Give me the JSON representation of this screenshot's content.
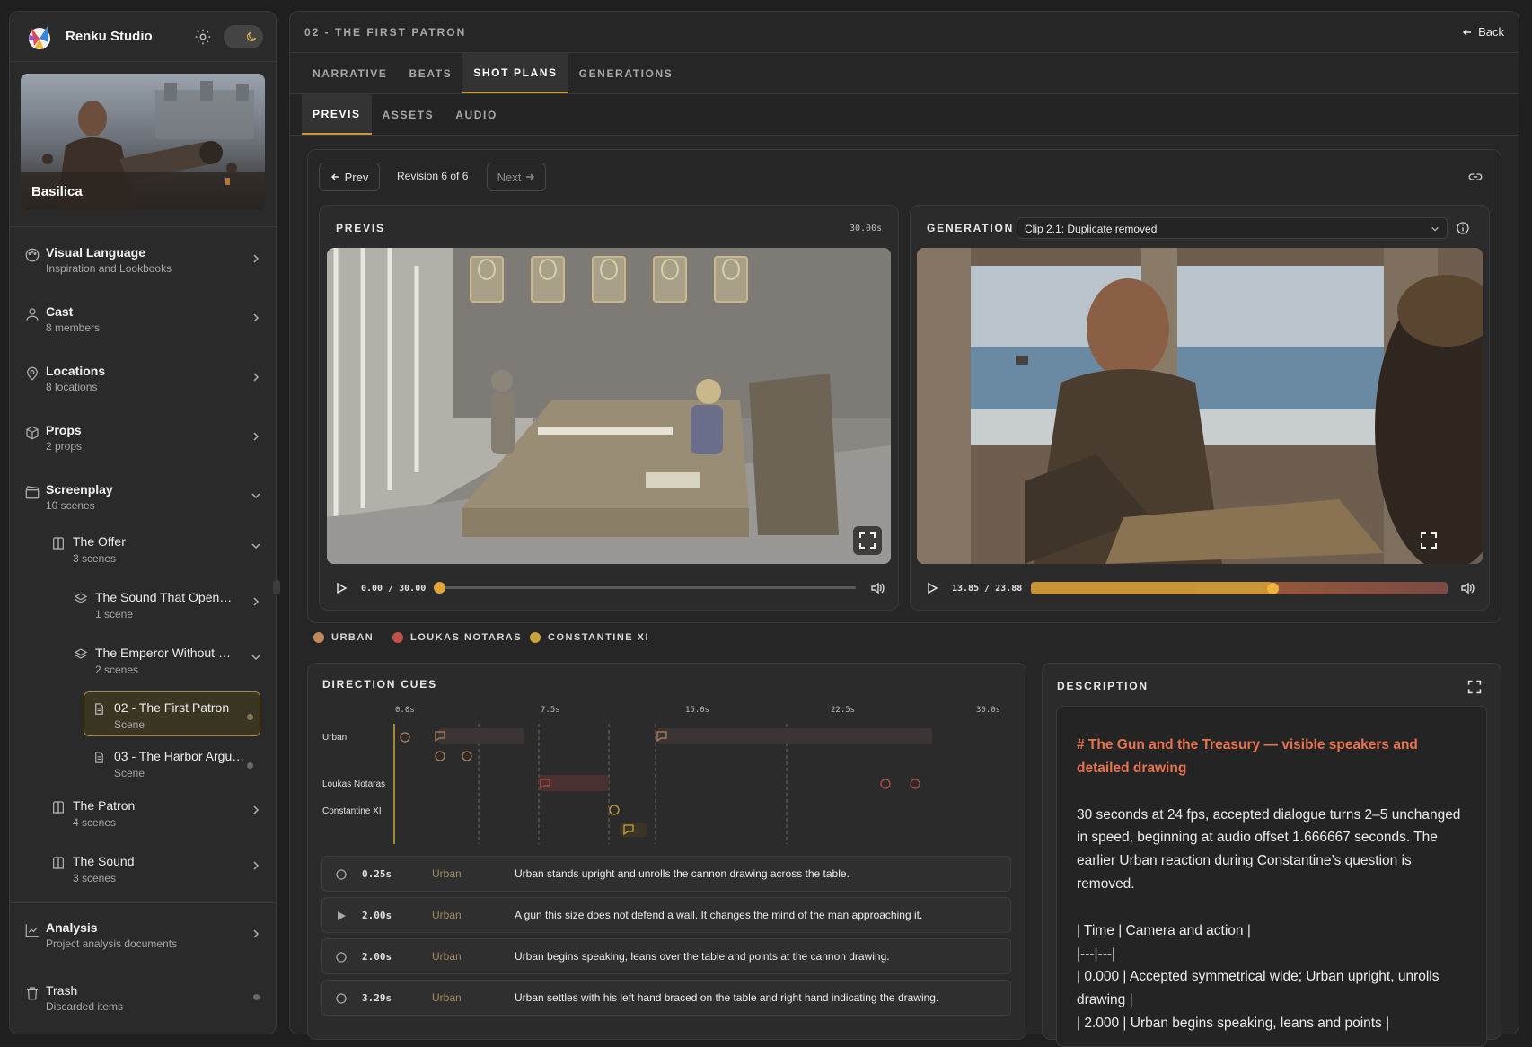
{
  "app": {
    "title": "Renku Studio"
  },
  "project": {
    "name": "Basilica"
  },
  "sidebar": {
    "items": [
      {
        "label": "Visual Language",
        "sub": "Inspiration and Lookbooks",
        "icon": "palette-icon"
      },
      {
        "label": "Cast",
        "sub": "8 members",
        "icon": "user-icon"
      },
      {
        "label": "Locations",
        "sub": "8 locations",
        "icon": "map-pin-icon"
      },
      {
        "label": "Props",
        "sub": "2 props",
        "icon": "box-icon"
      },
      {
        "label": "Screenplay",
        "sub": "10 scenes",
        "icon": "clapperboard-icon"
      },
      {
        "label": "Analysis",
        "sub": "Project analysis documents",
        "icon": "chart-icon"
      },
      {
        "label": "Trash",
        "sub": "Discarded items",
        "icon": "trash-icon"
      }
    ],
    "acts": [
      {
        "label": "The Offer",
        "sub": "3 scenes"
      },
      {
        "label": "The Patron",
        "sub": "4 scenes"
      },
      {
        "label": "The Sound",
        "sub": "3 scenes"
      }
    ],
    "sequences": [
      {
        "label": "The Sound That Open…",
        "sub": "1 scene"
      },
      {
        "label": "The Emperor Without …",
        "sub": "2 scenes"
      }
    ],
    "scenes": [
      {
        "label": "02 - The First Patron",
        "sub": "Scene"
      },
      {
        "label": "03 - The Harbor Argu…",
        "sub": "Scene"
      }
    ]
  },
  "header": {
    "breadcrumb": "02 - THE FIRST PATRON",
    "back_label": "Back"
  },
  "tabs": [
    "NARRATIVE",
    "BEATS",
    "SHOT PLANS",
    "GENERATIONS"
  ],
  "active_tab": "SHOT PLANS",
  "subtabs": [
    "PREVIS",
    "ASSETS",
    "AUDIO"
  ],
  "active_subtab": "PREVIS",
  "revision": {
    "prev_label": "Prev",
    "text": "Revision 6 of 6",
    "next_label": "Next"
  },
  "previs": {
    "title": "PREVIS",
    "duration": "30.00s",
    "time": "0.00 / 30.00",
    "progress": 0.0
  },
  "generation": {
    "title": "GENERATION",
    "clip": "Clip 2.1: Duplicate removed",
    "time": "13.85 / 23.88",
    "progress": 0.58
  },
  "legend": [
    {
      "name": "URBAN",
      "color": "#c08a5a"
    },
    {
      "name": "LOUKAS NOTARAS",
      "color": "#c0504a"
    },
    {
      "name": "CONSTANTINE XI",
      "color": "#c9a53a"
    }
  ],
  "direction_cues": {
    "title": "DIRECTION CUES",
    "ticks": [
      "0.0s",
      "7.5s",
      "15.0s",
      "22.5s",
      "30.0s"
    ],
    "tracks": [
      "Urban",
      "Loukas Notaras",
      "Constantine XI"
    ]
  },
  "cues": [
    {
      "time": "0.25s",
      "speaker": "Urban",
      "text": "Urban stands upright and unrolls the cannon drawing across the table.",
      "kind": "action"
    },
    {
      "time": "2.00s",
      "speaker": "Urban",
      "text": "A gun this size does not defend a wall. It changes the mind of the man approaching it.",
      "kind": "dialogue"
    },
    {
      "time": "2.00s",
      "speaker": "Urban",
      "text": "Urban begins speaking, leans over the table and points at the cannon drawing.",
      "kind": "action"
    },
    {
      "time": "3.29s",
      "speaker": "Urban",
      "text": "Urban settles with his left hand braced on the table and right hand indicating the drawing.",
      "kind": "action"
    }
  ],
  "description": {
    "title": "DESCRIPTION",
    "heading": "# The Gun and the Treasury — visible speakers and detailed drawing",
    "para": "30 seconds at 24 fps, accepted dialogue turns 2–5 unchanged in speed, beginning at audio offset 1.666667 seconds. The earlier Urban reaction during Constantine’s question is removed.",
    "lines": [
      "| Time | Camera and action |",
      "|---|---|",
      "| 0.000 | Accepted symmetrical wide; Urban upright, unrolls drawing |",
      "| 2.000 | Urban begins speaking, leans and points |"
    ]
  }
}
